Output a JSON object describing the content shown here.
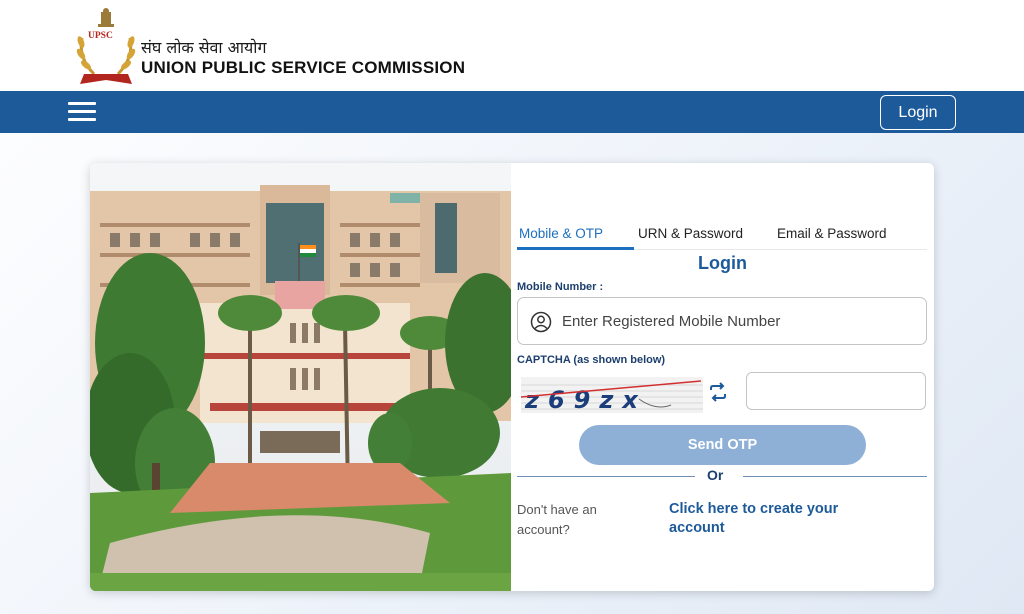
{
  "header": {
    "org_name_hindi": "संघ लोक सेवा आयोग",
    "org_name_english": "UNION PUBLIC SERVICE COMMISSION",
    "logo_text": "UPSC",
    "login_label": "Login"
  },
  "login_form": {
    "tabs": [
      {
        "label": "Mobile & OTP",
        "active": true
      },
      {
        "label": "URN & Password",
        "active": false
      },
      {
        "label": "Email & Password",
        "active": false
      }
    ],
    "title": "Login",
    "mobile_label": "Mobile Number :",
    "mobile_placeholder": "Enter Registered Mobile Number",
    "captcha_label": "CAPTCHA (as shown below)",
    "captcha_text": "z69zx",
    "captcha_value": "",
    "send_otp_label": "Send OTP",
    "or_label": "Or",
    "no_account_text": "Don't have an account?",
    "create_account_link": "Click here to create your account"
  },
  "colors": {
    "primary": "#1d5a9a",
    "tab_active": "#1d6fbf",
    "send_otp_bg": "#8eb0d6"
  },
  "icons": [
    "hamburger-menu-icon",
    "user-circle-icon",
    "refresh-icon",
    "upsc-emblem-logo"
  ]
}
